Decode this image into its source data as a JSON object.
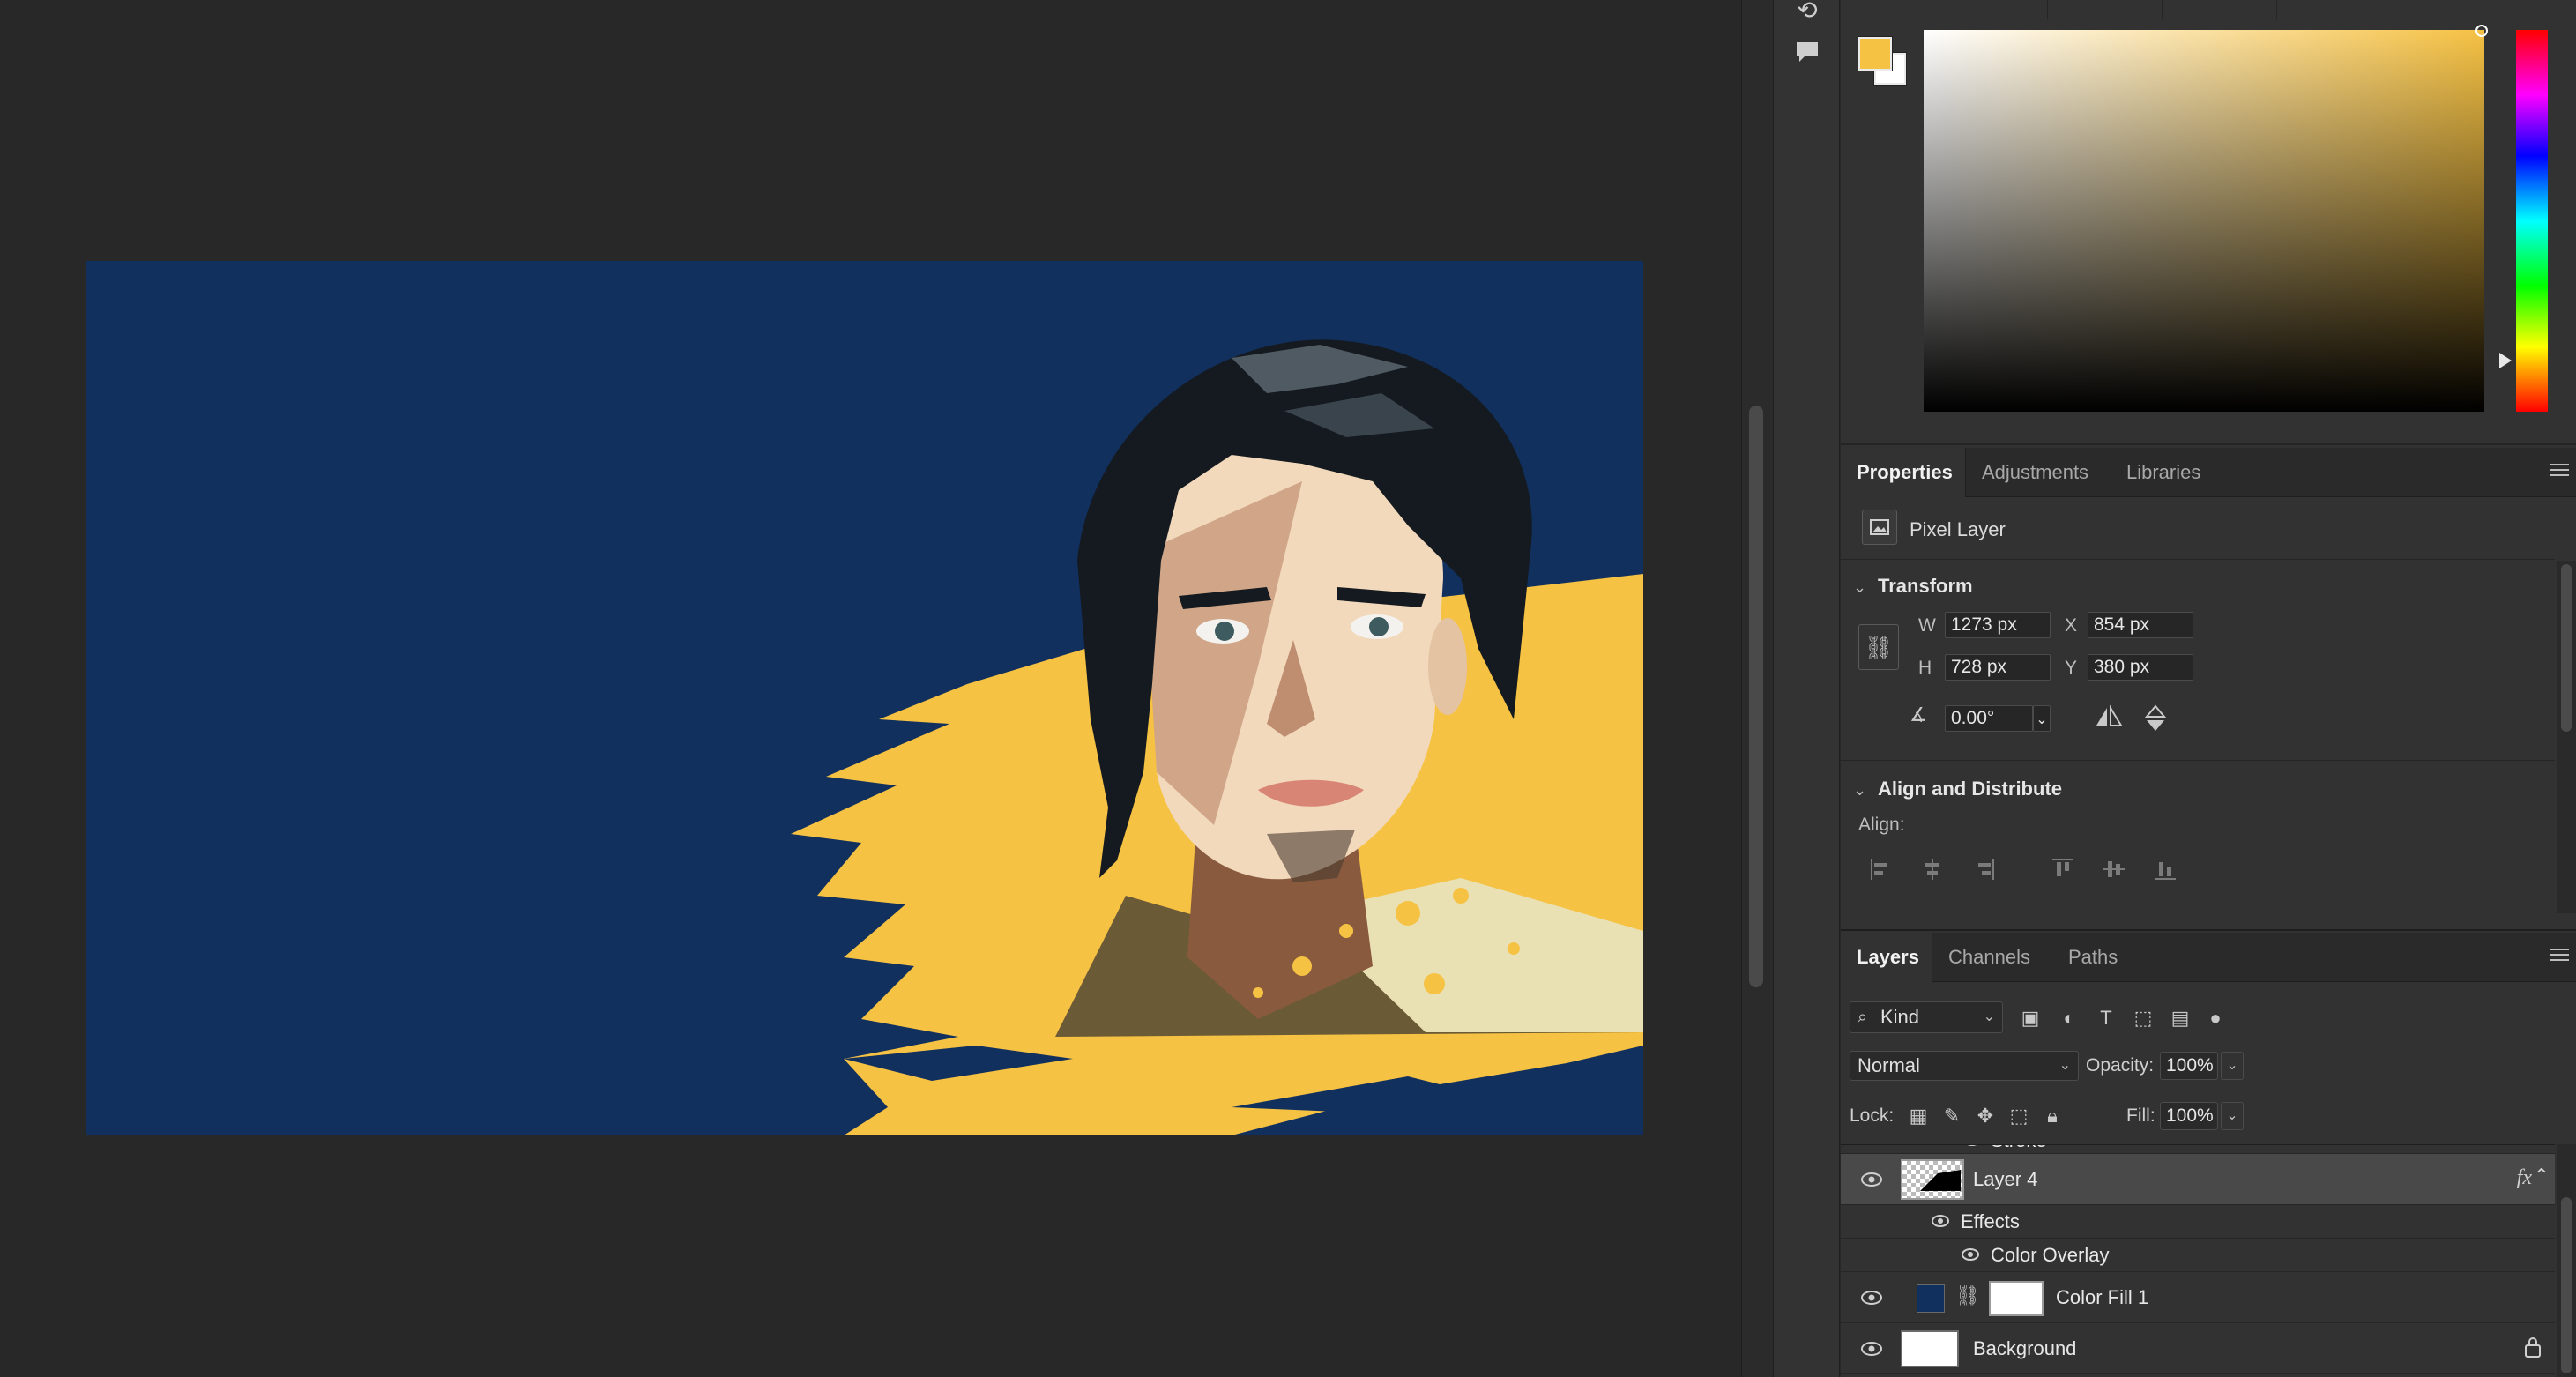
{
  "colors": {
    "foreground": "#f6c244",
    "background": "#ffffff",
    "canvas_bg": "#11305e",
    "accent_yellow": "#f6c244"
  },
  "properties": {
    "tabs": [
      "Properties",
      "Adjustments",
      "Libraries"
    ],
    "active_tab": "Properties",
    "layer_type": "Pixel Layer",
    "transform": {
      "title": "Transform",
      "w_label": "W",
      "w_value": "1273 px",
      "h_label": "H",
      "h_value": "728 px",
      "x_label": "X",
      "x_value": "854 px",
      "y_label": "Y",
      "y_value": "380 px",
      "angle_value": "0.00°"
    },
    "align": {
      "title": "Align and Distribute",
      "label": "Align:"
    }
  },
  "layers": {
    "tabs": [
      "Layers",
      "Channels",
      "Paths"
    ],
    "active_tab": "Layers",
    "kind_filter": "Kind",
    "blend_mode": "Normal",
    "opacity_label": "Opacity:",
    "opacity_value": "100%",
    "lock_label": "Lock:",
    "fill_label": "Fill:",
    "fill_value": "100%",
    "partial_above": "Stroke",
    "items": [
      {
        "name": "Layer 4",
        "selected": true,
        "has_fx": true
      },
      {
        "name": "Effects",
        "type": "effects-group"
      },
      {
        "name": "Color Overlay",
        "type": "effect"
      },
      {
        "name": "Color Fill 1",
        "fill_color": "#11305e"
      },
      {
        "name": "Background",
        "locked": true
      }
    ]
  }
}
